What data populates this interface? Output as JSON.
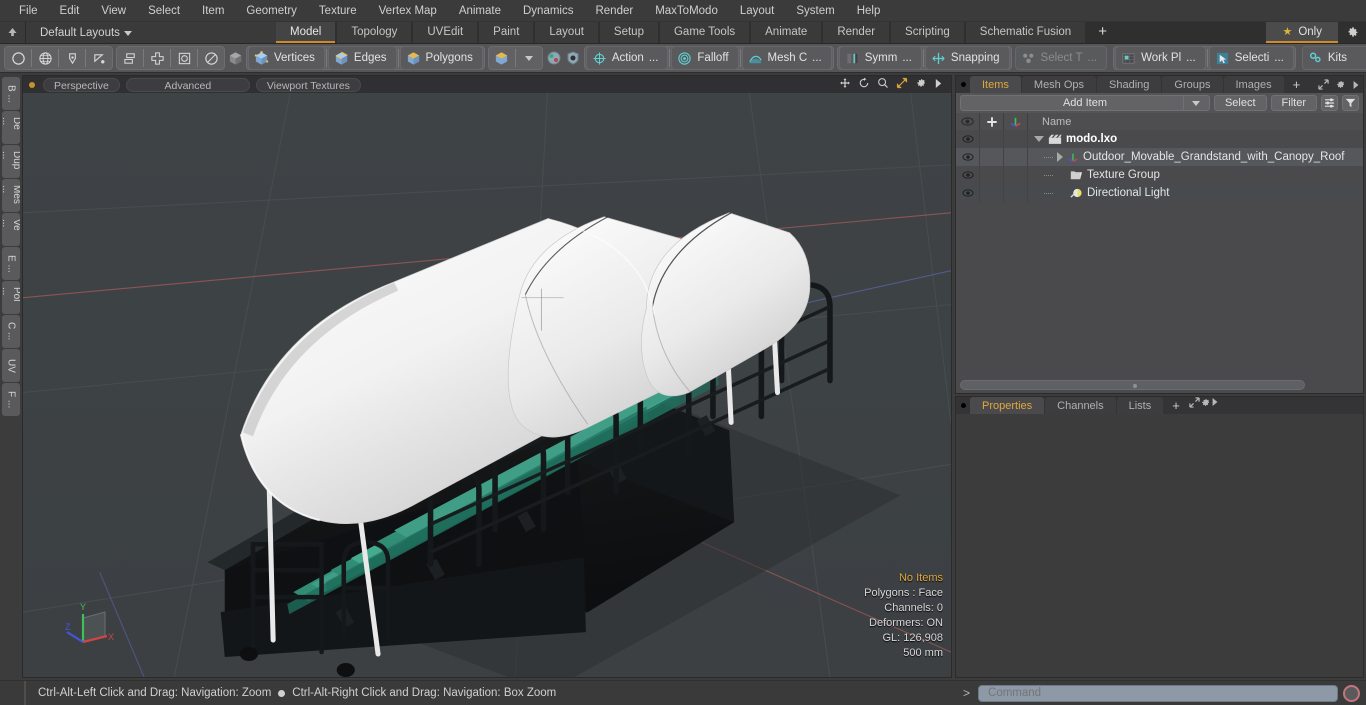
{
  "menubar": {
    "items": [
      "File",
      "Edit",
      "View",
      "Select",
      "Item",
      "Geometry",
      "Texture",
      "Vertex Map",
      "Animate",
      "Dynamics",
      "Render",
      "MaxToModo",
      "Layout",
      "System",
      "Help"
    ]
  },
  "layoutrow": {
    "layouts_label": "Default Layouts",
    "tabs": [
      {
        "label": "Model",
        "active": true
      },
      {
        "label": "Topology",
        "active": false
      },
      {
        "label": "UVEdit",
        "active": false
      },
      {
        "label": "Paint",
        "active": false
      },
      {
        "label": "Layout",
        "active": false
      },
      {
        "label": "Setup",
        "active": false
      },
      {
        "label": "Game Tools",
        "active": false
      },
      {
        "label": "Animate",
        "active": false
      },
      {
        "label": "Render",
        "active": false
      },
      {
        "label": "Scripting",
        "active": false
      },
      {
        "label": "Schematic Fusion",
        "active": false
      }
    ],
    "add_tab_label": "+",
    "only_label": "Only"
  },
  "toolbar": {
    "shape_tools": [
      "circle-icon",
      "globe-icon",
      "pen-icon",
      "curve-icon"
    ],
    "arrange_tools": [
      "stack-icon",
      "align-icon",
      "center-icon",
      "rotate-icon"
    ],
    "selection_modes": [
      {
        "label": "Vertices",
        "active": false
      },
      {
        "label": "Edges",
        "active": false
      },
      {
        "label": "Polygons",
        "active": false
      }
    ],
    "action_label": "Action",
    "action_suffix": "...",
    "falloff_label": "Falloff",
    "meshc_label": "Mesh C",
    "meshc_suffix": "...",
    "symm_label": "Symm",
    "symm_suffix": "...",
    "snapping_label": "Snapping",
    "select_through_label": "Select T",
    "select_through_suffix": "...",
    "workplane_label": "Work Pl",
    "workplane_suffix": "...",
    "selection_label": "Selecti",
    "selection_suffix": "...",
    "kits_label": "Kits"
  },
  "vtabs": {
    "items": [
      "B ...",
      "De ...",
      "Dup ...",
      "Mes ...",
      "Ve ...",
      "E ...",
      "Pol ...",
      "C ...",
      "UV",
      "F ..."
    ]
  },
  "viewport": {
    "header": {
      "view_mode": "Perspective",
      "shading": "Advanced",
      "display": "Viewport Textures",
      "icons": [
        "move-icon",
        "rotate-icon",
        "zoom-icon",
        "fit-icon",
        "gear-icon",
        "chevron-right-icon"
      ]
    },
    "stats": {
      "selection": "No Items",
      "polygons": "Polygons : Face",
      "channels": "Channels: 0",
      "deformers": "Deformers: ON",
      "gl": "GL: 126,908",
      "grid": "500 mm"
    },
    "gizmo": {
      "x": "X",
      "y": "Y",
      "z": "Z"
    },
    "background_color": "#3f4346"
  },
  "right_panel": {
    "tabs": [
      {
        "label": "Items",
        "active": true
      },
      {
        "label": "Mesh Ops",
        "active": false
      },
      {
        "label": "Shading",
        "active": false
      },
      {
        "label": "Groups",
        "active": false
      },
      {
        "label": "Images",
        "active": false
      }
    ],
    "add_tab_label": "+",
    "add_item_label": "Add Item",
    "select_label": "Select",
    "filter_label": "Filter",
    "tree_header": {
      "name": "Name",
      "cols": [
        "eye-icon",
        "lock-icon",
        "axis-icon"
      ]
    },
    "tree": [
      {
        "label": "modo.lxo",
        "depth": 0,
        "icon": "scene-icon",
        "bold": true,
        "expanded": true,
        "selected": false
      },
      {
        "label": "Outdoor_Movable_Grandstand_with_Canopy_Roof",
        "depth": 1,
        "icon": "mesh-icon",
        "collapsed": true,
        "selected": true
      },
      {
        "label": "Texture Group",
        "depth": 1,
        "icon": "folder-icon",
        "selected": false
      },
      {
        "label": "Directional Light",
        "depth": 1,
        "icon": "light-icon",
        "selected": false
      }
    ],
    "bottom_tabs": [
      {
        "label": "Properties",
        "active": true
      },
      {
        "label": "Channels",
        "active": false
      },
      {
        "label": "Lists",
        "active": false
      }
    ],
    "bottom_add_label": "+"
  },
  "status": {
    "hint_left": "Ctrl-Alt-Left Click and Drag: Navigation: Zoom",
    "hint_right": "Ctrl-Alt-Right Click and Drag: Navigation: Box Zoom",
    "command_prompt": ">",
    "command_placeholder": "Command"
  },
  "colors": {
    "accent_orange": "#d08a28",
    "highlight_text": "#e2a83c",
    "toolbar_bg": "#555557",
    "panel_bg": "#3c3c3c",
    "viewport_bg": "#3f4346",
    "command_field": "#8d99a6"
  }
}
